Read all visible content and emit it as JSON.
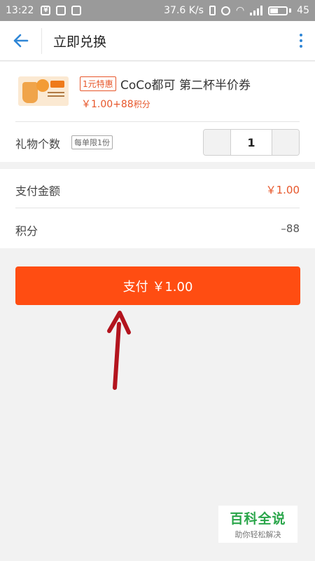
{
  "status_bar": {
    "time": "13:22",
    "network_speed": "37.6 K/s",
    "battery": "45",
    "battery_level": 0.45
  },
  "header": {
    "title": "立即兑换"
  },
  "product": {
    "badge": "1元特惠",
    "name": "CoCo都可 第二杯半价券",
    "price": "￥1.00+88",
    "points_unit": "积分"
  },
  "quantity": {
    "label": "礼物个数",
    "limit": "每单限1份",
    "value": "1"
  },
  "summary": {
    "amount_label": "支付金额",
    "amount_value": "￥1.00",
    "points_label": "积分",
    "points_value": "–88"
  },
  "pay_button": {
    "label": "支付 ￥1.00"
  },
  "watermark": {
    "title": "百科全说",
    "subtitle": "助你轻松解决"
  },
  "colors": {
    "accent": "#ff4d12",
    "price_red": "#e7562a",
    "back_blue": "#2f86d6",
    "watermark_green": "#2aa64a",
    "arrow_red": "#b3141e"
  }
}
